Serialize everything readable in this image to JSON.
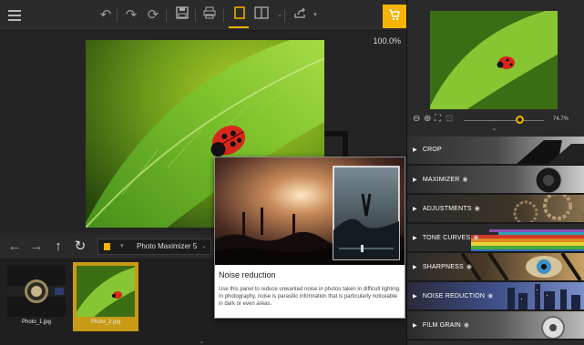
{
  "toolbar": {
    "menu_icon": "hamburger-icon",
    "undo_icon": "undo-icon",
    "redo_icon": "redo-icon",
    "redo_all_icon": "redo-all-icon",
    "save_icon": "save-icon",
    "print_icon": "print-icon",
    "single_view_icon": "single-view-icon",
    "compare_view_icon": "compare-view-icon",
    "share_icon": "share-icon",
    "cart_icon": "cart-icon",
    "accent": "#f5b400"
  },
  "canvas": {
    "zoom_percent": "100.0%"
  },
  "navbar": {
    "preset_name": "Photo Maximizer 5"
  },
  "filmstrip": {
    "items": [
      {
        "name": "Photo_1.jpg",
        "selected": false
      },
      {
        "name": "Photo_2.jpg",
        "selected": true
      }
    ]
  },
  "tooltip": {
    "title": "Noise reduction",
    "line1": "Use this panel to reduce unwanted noise in photos taken in difficult lighting.",
    "line2": "In photography, noise is parasitic information that is particularly noticeable in dark or even areas."
  },
  "rightpanel": {
    "zoom_value": "74.7%",
    "zoom_fraction": 0.7,
    "sections": [
      {
        "label": "CROP",
        "eye": false
      },
      {
        "label": "MAXIMIZER",
        "eye": true
      },
      {
        "label": "ADJUSTMENTS",
        "eye": true
      },
      {
        "label": "TONE CURVES",
        "eye": true
      },
      {
        "label": "SHARPNESS",
        "eye": true
      },
      {
        "label": "NOISE REDUCTION",
        "eye": true
      },
      {
        "label": "FILM GRAIN",
        "eye": true
      }
    ]
  }
}
